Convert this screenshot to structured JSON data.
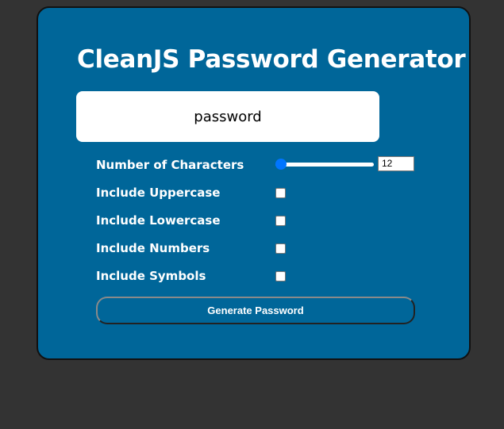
{
  "app": {
    "title": "CleanJS Password Generator"
  },
  "output": {
    "value": "password"
  },
  "options": {
    "length": {
      "label": "Number of Characters",
      "value": "12",
      "slider_fraction": 0.0
    },
    "uppercase": {
      "label": "Include Uppercase",
      "checked": false
    },
    "lowercase": {
      "label": "Include Lowercase",
      "checked": false
    },
    "numbers": {
      "label": "Include Numbers",
      "checked": false
    },
    "symbols": {
      "label": "Include Symbols",
      "checked": false
    }
  },
  "actions": {
    "generate_label": "Generate Password"
  },
  "colors": {
    "page_background": "#333333",
    "card_background": "#006699",
    "accent": "#0075ff",
    "text": "#ffffff"
  }
}
